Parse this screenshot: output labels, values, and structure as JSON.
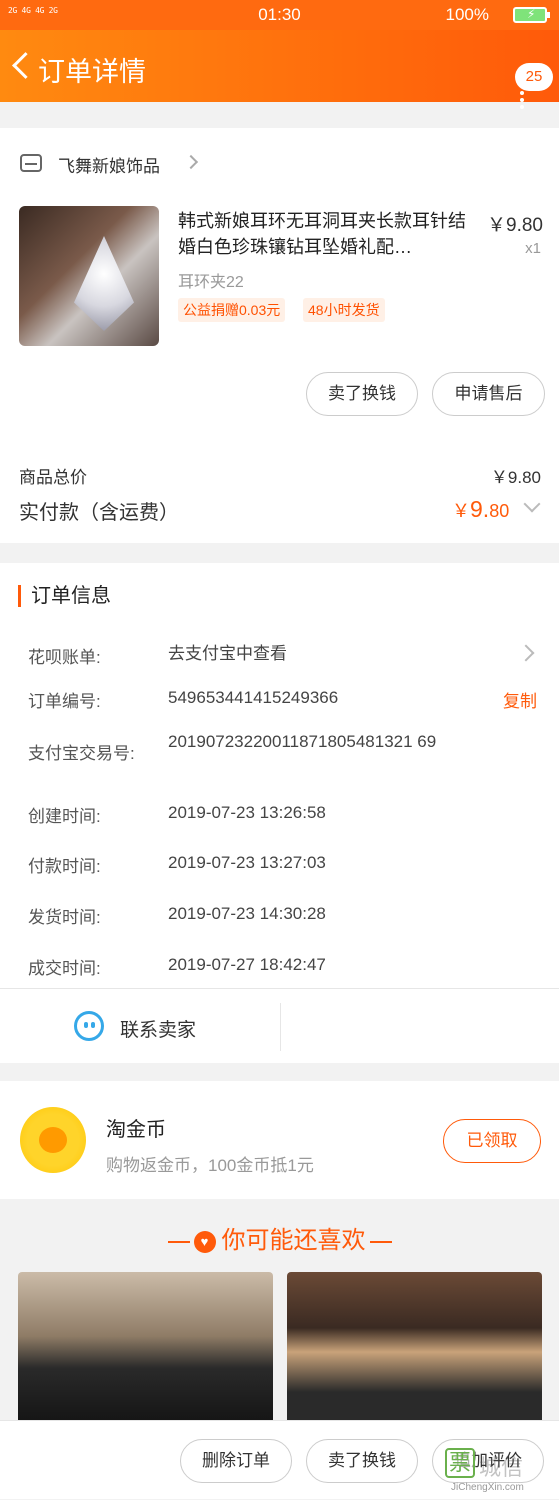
{
  "status": {
    "signal": "2G 4G 4G\n2G",
    "time": "01:30",
    "battery": "100%"
  },
  "nav": {
    "title": "订单详情",
    "badge": "25"
  },
  "product": {
    "shop": "飞舞新娘饰品",
    "title": "韩式新娘耳环无耳洞耳夹长款耳针结婚白色珍珠镶钻耳坠婚礼配…",
    "price": "￥9.80",
    "qty": "x1",
    "sku": "耳环夹22",
    "tags": [
      "公益捐赠0.03元",
      "48小时发货"
    ],
    "actions": [
      "卖了换钱",
      "申请售后"
    ]
  },
  "totals": {
    "goods_label": "商品总价",
    "goods_value": "￥9.80",
    "paid_label": "实付款（含运费）",
    "paid_currency": "￥",
    "paid_int": "9.",
    "paid_dec": "80"
  },
  "order": {
    "title": "订单信息",
    "rows": [
      {
        "k": "花呗账单:",
        "v": "去支付宝中查看"
      },
      {
        "k": "订单编号:",
        "v": "549653441415249366",
        "action": "复制"
      },
      {
        "k": "支付宝交易号:",
        "v": "20190723220011871805481321 69"
      },
      {
        "k": "创建时间:",
        "v": "2019-07-23 13:26:58"
      },
      {
        "k": "付款时间:",
        "v": "2019-07-23 13:27:03"
      },
      {
        "k": "发货时间:",
        "v": "2019-07-23 14:30:28"
      },
      {
        "k": "成交时间:",
        "v": "2019-07-27 18:42:47"
      }
    ],
    "contact": "联系卖家"
  },
  "coins": {
    "title": "淘金币",
    "desc": "购物返金币，100金币抵1元",
    "button": "已领取"
  },
  "recommend": {
    "title": "你可能还喜欢"
  },
  "bottom": {
    "buttons": [
      "删除订单",
      "卖了换钱",
      "追加评价"
    ]
  },
  "watermark": {
    "brand": "JiChengXin.com"
  }
}
